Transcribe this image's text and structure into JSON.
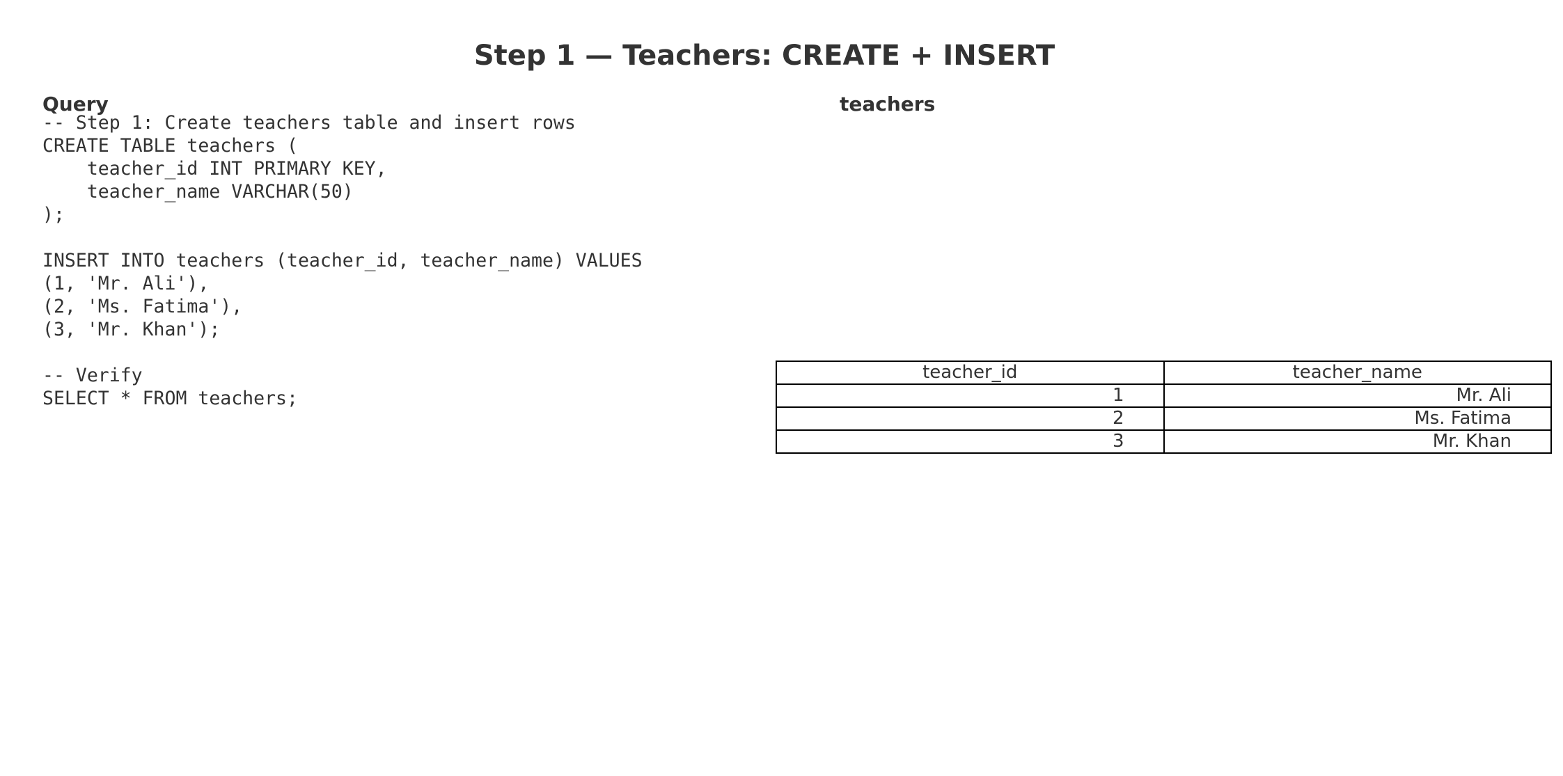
{
  "page": {
    "title": "Step 1 — Teachers: CREATE + INSERT"
  },
  "query": {
    "heading": "Query",
    "code": "-- Step 1: Create teachers table and insert rows\nCREATE TABLE teachers (\n    teacher_id INT PRIMARY KEY,\n    teacher_name VARCHAR(50)\n);\n\nINSERT INTO teachers (teacher_id, teacher_name) VALUES\n(1, 'Mr. Ali'),\n(2, 'Ms. Fatima'),\n(3, 'Mr. Khan');\n\n-- Verify\nSELECT * FROM teachers;"
  },
  "result": {
    "heading": "teachers",
    "columns": [
      "teacher_id",
      "teacher_name"
    ],
    "rows": [
      [
        "1",
        "Mr. Ali"
      ],
      [
        "2",
        "Ms. Fatima"
      ],
      [
        "3",
        "Mr. Khan"
      ]
    ]
  }
}
